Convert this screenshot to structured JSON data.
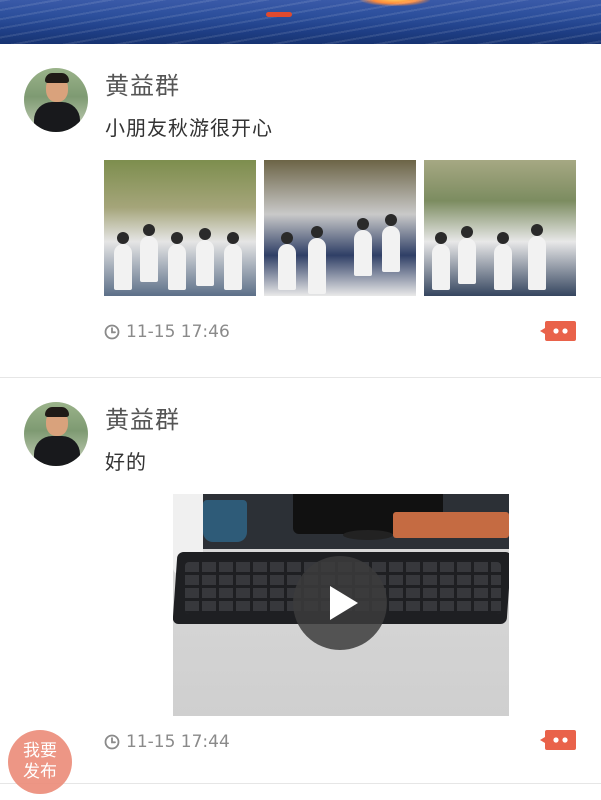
{
  "posts": [
    {
      "author": "黄益群",
      "text": "小朋友秋游很开心",
      "time": "11-15 17:46",
      "media_type": "photos",
      "photo_count": 3
    },
    {
      "author": "黄益群",
      "text": "好的",
      "time": "11-15 17:44",
      "media_type": "video"
    }
  ],
  "fab": {
    "line1": "我要",
    "line2": "发布"
  },
  "icons": {
    "clock": "clock-icon",
    "comment": "comment-icon",
    "play": "play-icon"
  },
  "colors": {
    "accent": "#e9624a",
    "fab": "#ec8e7b",
    "meta_text": "#8a8a8a"
  }
}
